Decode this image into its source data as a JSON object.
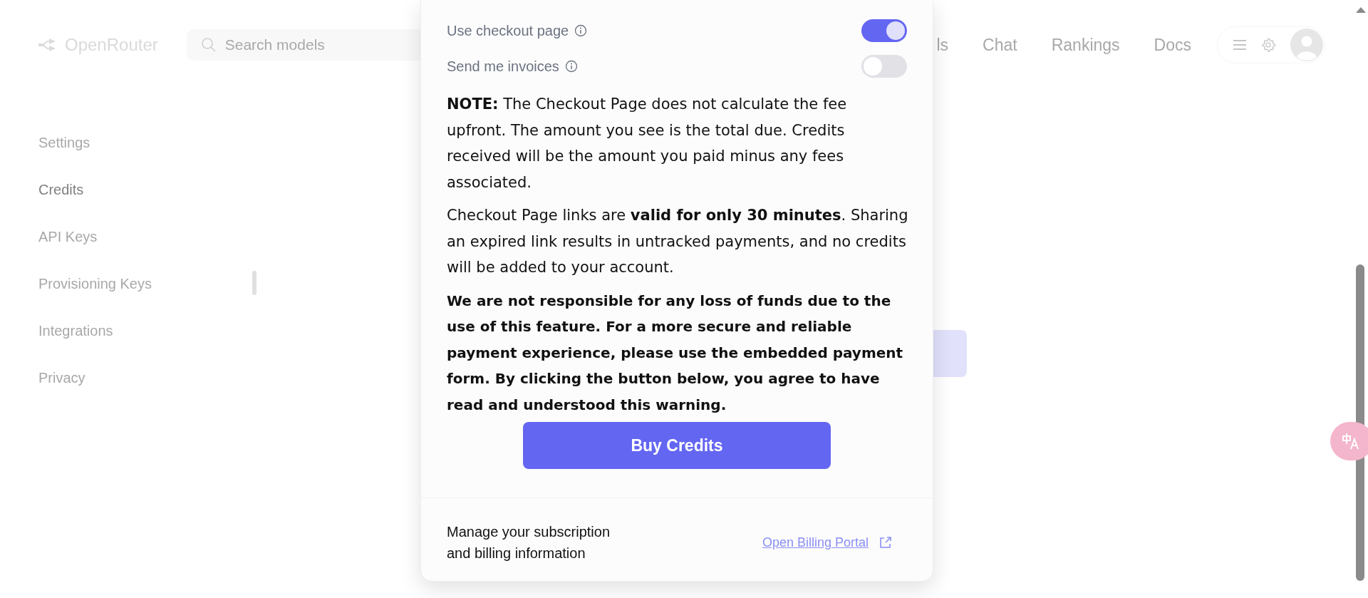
{
  "header": {
    "logo": "OpenRouter",
    "search": {
      "placeholder": "Search models"
    },
    "nav": [
      {
        "label": "ls"
      },
      {
        "label": "Chat"
      },
      {
        "label": "Rankings"
      },
      {
        "label": "Docs"
      }
    ]
  },
  "sidebar": {
    "items": [
      {
        "label": "Settings",
        "selected": false
      },
      {
        "label": "Credits",
        "selected": true
      },
      {
        "label": "API Keys",
        "selected": false
      },
      {
        "label": "Provisioning Keys",
        "selected": false
      },
      {
        "label": "Integrations",
        "selected": false
      },
      {
        "label": "Privacy",
        "selected": false
      }
    ]
  },
  "dialog": {
    "toggles": [
      {
        "label": "Use checkout page",
        "on": true
      },
      {
        "label": "Send me invoices",
        "on": false
      }
    ],
    "paragraphs": [
      {
        "text": "**NOTE:** The Checkout Page does not calculate the fee upfront. The amount you see is the total due. Credits received will be the amount you paid minus any fees associated.",
        "bold": false
      },
      {
        "text": "Checkout Page links are **valid for only 30 minutes**. Sharing an expired link results in untracked payments, and no credits will be added to your account.",
        "bold": false
      },
      {
        "text": "We are not responsible for any loss of funds due to the use of this feature. For a more secure and reliable payment experience, please use the embedded payment form. By clicking the button below, you agree to have read and understood this warning.",
        "bold": true
      }
    ],
    "button": "Buy Credits",
    "footer": {
      "text": "Manage your subscription and billing information",
      "link": "Open Billing Portal"
    }
  }
}
